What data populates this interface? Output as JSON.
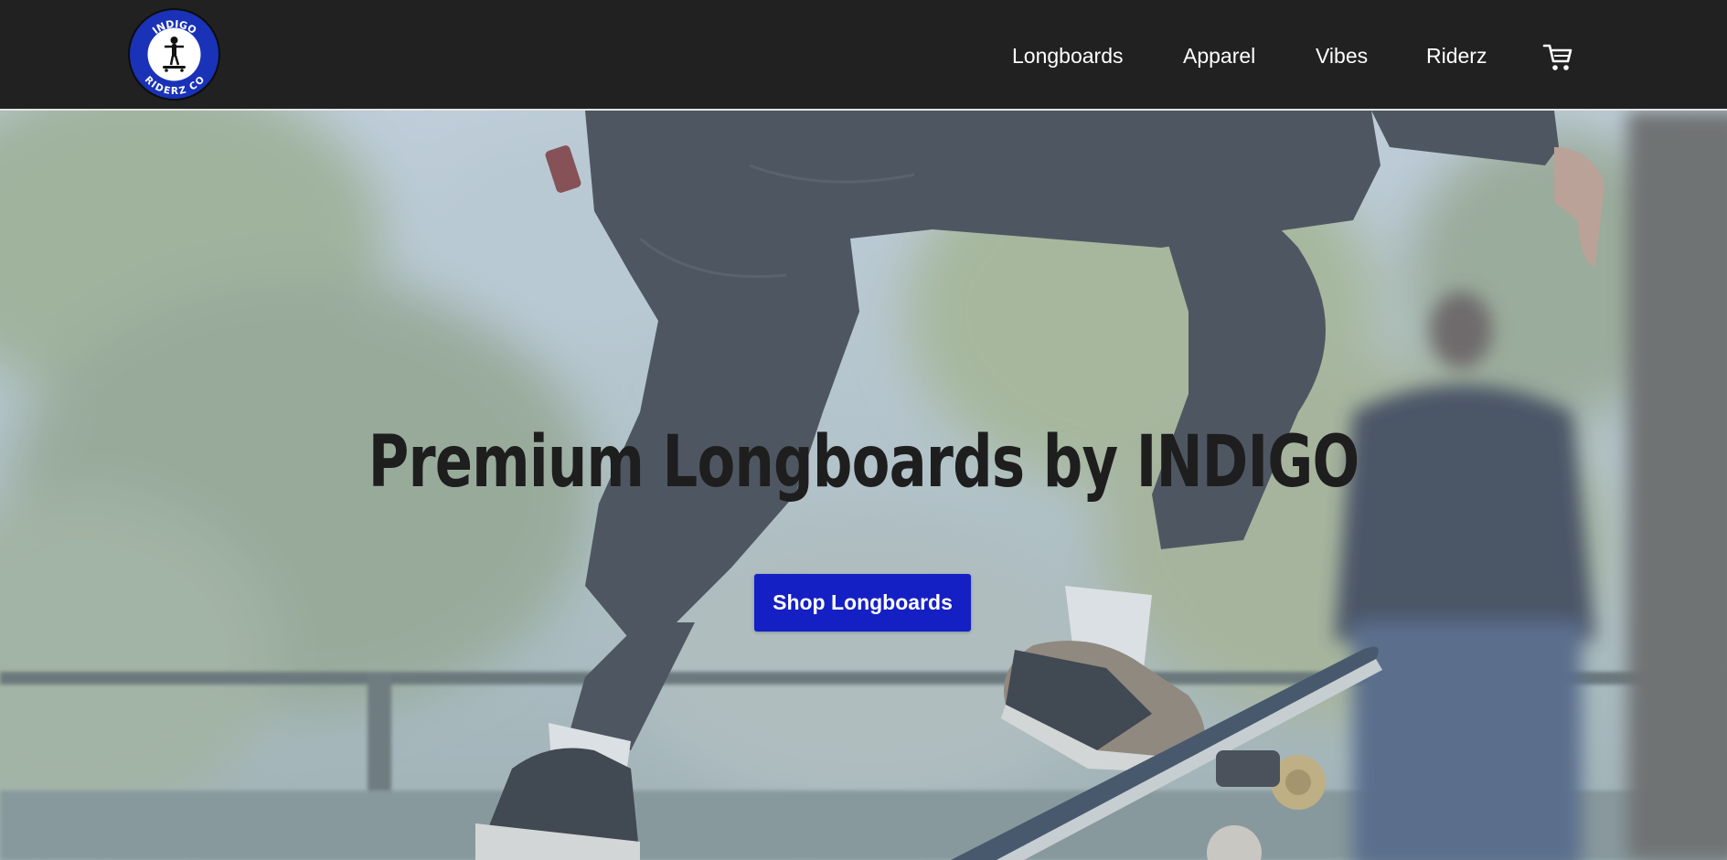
{
  "header": {
    "logo": {
      "top_text": "INDIGO",
      "bottom_text": "RIDERZ CO"
    },
    "nav": [
      {
        "label": "Longboards"
      },
      {
        "label": "Apparel"
      },
      {
        "label": "Vibes"
      },
      {
        "label": "Riderz"
      }
    ],
    "cart_icon": "cart-icon"
  },
  "hero": {
    "title": "Premium Longboards by INDIGO",
    "cta_label": "Shop Longboards",
    "image_subject": "skateboarder performing a trick in a park"
  },
  "colors": {
    "header_bg": "#212121",
    "accent": "#1520c4",
    "logo_blue": "#1a32b8",
    "title_text": "#1e1e1e"
  }
}
